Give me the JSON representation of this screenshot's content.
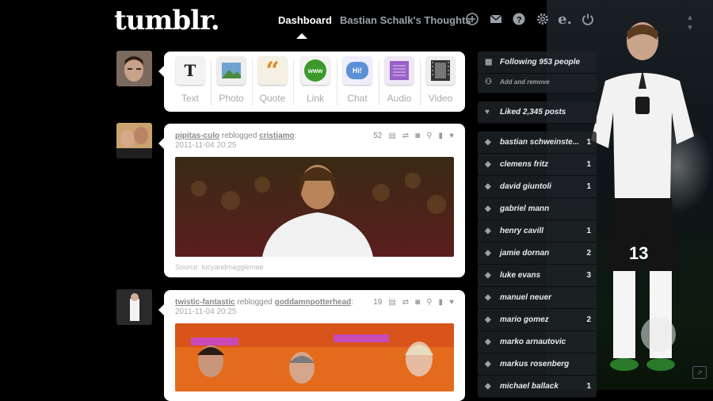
{
  "header": {
    "logo": "tumblr.",
    "nav": {
      "dashboard": "Dashboard",
      "blog": "Bastian Schalk's Thoughts"
    },
    "icons": [
      "plus-circle-icon",
      "mail-icon",
      "help-icon",
      "gear-icon",
      "e-icon",
      "power-icon"
    ]
  },
  "composer": {
    "types": [
      {
        "label": "Text",
        "glyph": "T"
      },
      {
        "label": "Photo",
        "glyph": ""
      },
      {
        "label": "Quote",
        "glyph": "“"
      },
      {
        "label": "Link",
        "glyph": "www"
      },
      {
        "label": "Chat",
        "glyph": "Hi!"
      },
      {
        "label": "Audio",
        "glyph": ""
      },
      {
        "label": "Video",
        "glyph": ""
      }
    ]
  },
  "posts": [
    {
      "user": "pipitas-culo",
      "action": "reblogged",
      "source_user": "cristiamo",
      "date": "2011-11-04 20:25",
      "notes": "52",
      "source": "Source: lucyandmaggiemae"
    },
    {
      "user": "twistic-fantastic",
      "action": "reblogged",
      "source_user": "goddamnpotterhead",
      "date": "2011-11-04 20:25",
      "notes": "19"
    }
  ],
  "sidebar": {
    "following": "Following 953 people",
    "add_remove": "Add and remove",
    "liked": "Liked 2,345 posts",
    "tags": [
      {
        "name": "bastian schweinste...",
        "count": "1"
      },
      {
        "name": "clemens fritz",
        "count": "1"
      },
      {
        "name": "david giuntoli",
        "count": "1"
      },
      {
        "name": "gabriel mann",
        "count": ""
      },
      {
        "name": "henry cavill",
        "count": "1"
      },
      {
        "name": "jamie dornan",
        "count": "2"
      },
      {
        "name": "luke evans",
        "count": "3"
      },
      {
        "name": "manuel neuer",
        "count": ""
      },
      {
        "name": "mario gomez",
        "count": "2"
      },
      {
        "name": "marko arnautovic",
        "count": ""
      },
      {
        "name": "markus rosenberg",
        "count": ""
      },
      {
        "name": "michael ballack",
        "count": "1"
      }
    ]
  },
  "player": {
    "number": "13"
  },
  "colors": {
    "background": "#000000",
    "card": "#ffffff",
    "nav_inactive": "#9aa0a6"
  }
}
